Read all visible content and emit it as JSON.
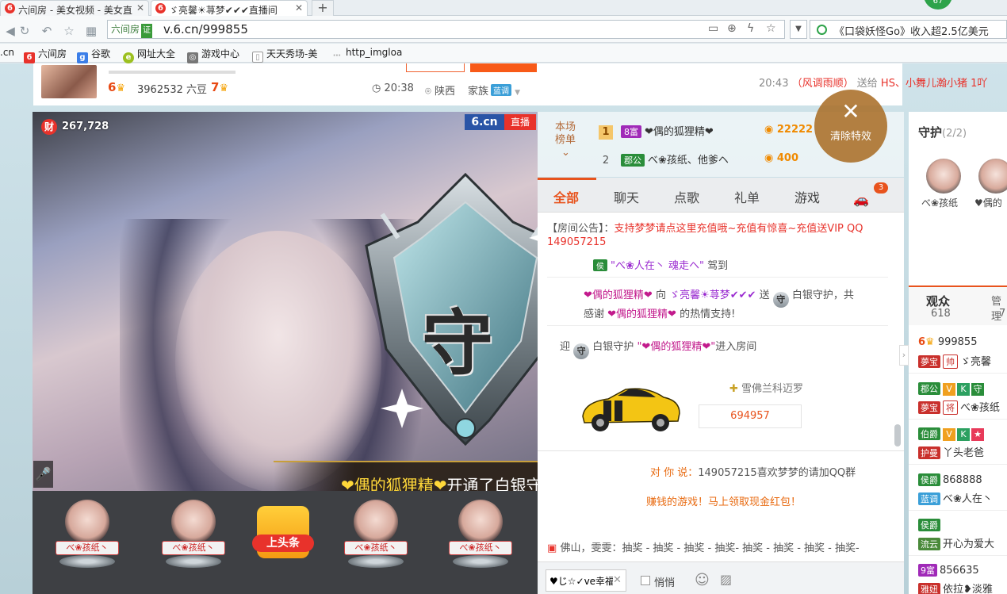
{
  "browser": {
    "tabs": [
      {
        "icon": "6",
        "title": "六间房 - 美女视频 - 美女直"
      },
      {
        "icon": "6",
        "title": "ゞ亮馨☀荨梦✔✔✔直播间"
      }
    ],
    "newtab": "+",
    "badge": "67",
    "site_tag": "六间房",
    "cert": "证",
    "url": "v.6.cn/999855",
    "news": "《口袋妖怪Go》收入超2.5亿美元",
    "bookmarks": [
      ".cn",
      "六间房",
      "谷歌",
      "网址大全",
      "游戏中心",
      "天天秀场-美",
      "http_imgloa"
    ]
  },
  "host": {
    "level_left": "6",
    "beans": "3962532 六豆",
    "level_right": "7",
    "time": "20:38",
    "region": "陕西",
    "family": "家族",
    "family_badge": "蓝调"
  },
  "gift_news": {
    "time": "20:43",
    "sender": "（风调雨顺）",
    "verb": "送给",
    "receivers": "HS、小舞儿瀚小猪 1吖"
  },
  "video": {
    "cai": "财",
    "viewers": "267,728",
    "logo": "6.cn",
    "live": "直播",
    "mic": "🎤",
    "shield_char": "守",
    "banner_user": "❤偶的狐狸精❤",
    "banner_action": "开通了白银守护！"
  },
  "fans": [
    {
      "name": "べ❀孩纸丶"
    },
    {
      "name": "べ❀孩纸丶"
    },
    {
      "name": "べ❀孩纸丶"
    },
    {
      "name": "べ❀孩纸丶"
    }
  ],
  "toutiao": "上头条",
  "rank": {
    "label": "本场榜单",
    "chevron": "⌄",
    "rows": [
      {
        "num": "1",
        "badge": "8富",
        "name": "❤偶的狐狸精❤",
        "coins": "22222"
      },
      {
        "num": "2",
        "badge": "郡公",
        "name": "べ❀孩纸、他爹ヘ",
        "coins": "400"
      }
    ]
  },
  "clear_effects": {
    "icon": "✕",
    "label": "清除特效"
  },
  "chat_tabs": [
    "全部",
    "聊天",
    "点歌",
    "礼单",
    "游戏"
  ],
  "car_badge": "3",
  "chat": {
    "announce_label": "【房间公告】：",
    "announce_text": "支持梦梦请点这里充值哦~充值有惊喜~充值送VIP QQ",
    "announce_text2": "149057215",
    "arrive_user": "\"べ❀人在丶 魂走ヘ\"",
    "arrive_action": "驾到",
    "gift_user": "❤偶的狐狸精❤",
    "gift_to": "向",
    "gift_host": "ゞ亮馨☀荨梦✔✔✔",
    "gift_send": "送",
    "gift_item": "白银守护，共",
    "thanks_pre": "感谢",
    "thanks_user": "❤偶的狐狸精❤",
    "thanks_post": "的热情支持!",
    "welcome_pre": "迎",
    "welcome_item": "白银守护",
    "welcome_user": "\"❤偶的狐狸精❤\"",
    "welcome_post": "进入房间",
    "car_name": "雪佛兰科迈罗",
    "car_number": "694957",
    "host_say_to": "对 你 说：",
    "host_say": "149057215喜欢梦梦的请加QQ群",
    "promo": "赚钱的游戏！马上领取现金红包！",
    "lottery_user": "佛山，雯雯：",
    "lottery_text": "抽奖 - 抽奖 - 抽奖 - 抽奖- 抽奖 - 抽奖 - 抽奖 - 抽奖-"
  },
  "input": {
    "value": "♥じ☆✓ve幸福",
    "clear": "✕",
    "whisper": "悄悄"
  },
  "guard": {
    "title": "守护",
    "count": "(2/2)",
    "members": [
      "べ❀孩纸",
      "♥偶的"
    ]
  },
  "audience": {
    "label": "观众",
    "count": "618",
    "mgr_label": "管理",
    "mgr_count": "7"
  },
  "users": [
    {
      "level": "6",
      "name": "999855",
      "tag": "夢宝",
      "tag2": "帅",
      "extra": "ゞ亮馨"
    },
    {
      "level_badge": "郡公",
      "name": "べ❀孩纸",
      "tag": "夢宝",
      "tag2": "将"
    },
    {
      "level_badge": "伯爵",
      "name": "丫头老爸",
      "tag": "护曼"
    },
    {
      "level_badge": "侯爵",
      "name": "868888",
      "tag": "蓝调",
      "extra": "べ❀人在丶"
    },
    {
      "level_badge": "侯爵",
      "name": "开心为爱大",
      "tag": "流云"
    },
    {
      "level_badge": "9富",
      "name": "856635",
      "tag": "雅妞",
      "extra": "依拉❥淡雅"
    }
  ]
}
